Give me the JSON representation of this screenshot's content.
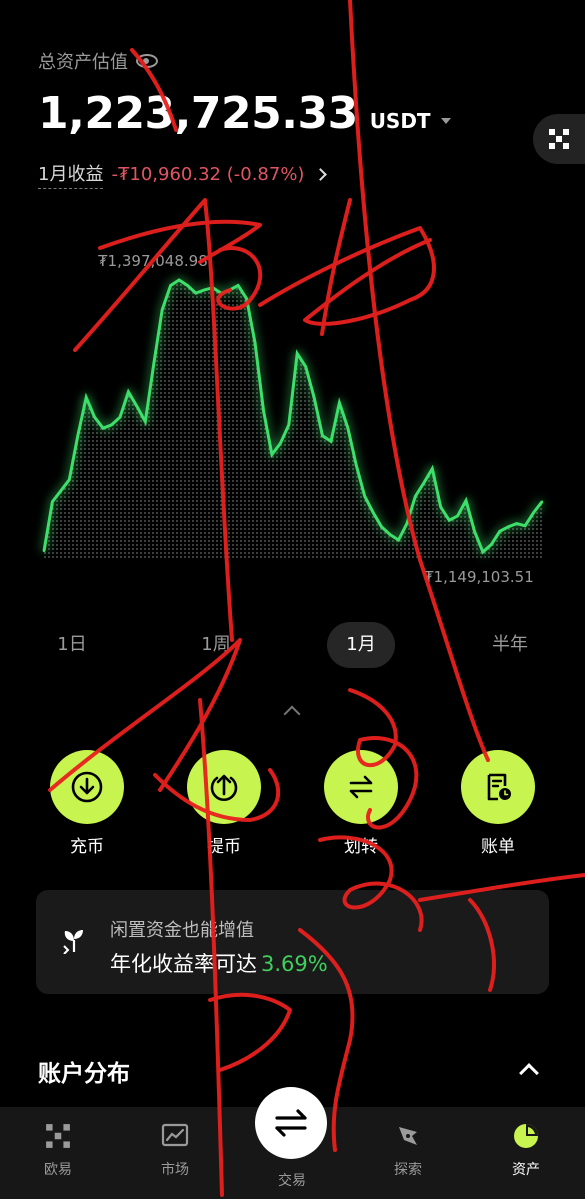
{
  "header": {
    "total_label": "总资产估值",
    "balance": "1,223,725.33",
    "currency": "USDT",
    "pnl_label": "1月收益",
    "pnl_value": "-₮10,960.32 (-0.87%)"
  },
  "chart": {
    "high_label": "₮1,397,048.98",
    "low_label": "₮1,149,103.51",
    "line_color": "#3ee06a"
  },
  "chart_data": {
    "type": "area",
    "title": "",
    "ylim": [
      1149103.51,
      1397048.98
    ],
    "values": [
      1150000,
      1195000,
      1205000,
      1215000,
      1255000,
      1290000,
      1272000,
      1262000,
      1265000,
      1272000,
      1295000,
      1282000,
      1268000,
      1320000,
      1370000,
      1392000,
      1397048.98,
      1392000,
      1385000,
      1388000,
      1390000,
      1385000,
      1388000,
      1392000,
      1380000,
      1340000,
      1278000,
      1238000,
      1248000,
      1265000,
      1330000,
      1318000,
      1290000,
      1255000,
      1250000,
      1285000,
      1262000,
      1228000,
      1200000,
      1185000,
      1172000,
      1165000,
      1160000,
      1175000,
      1200000,
      1212000,
      1225000,
      1190000,
      1178000,
      1182000,
      1196000,
      1168000,
      1149103.51,
      1156000,
      1168000,
      1172000,
      1175000,
      1173000,
      1185000,
      1195000
    ]
  },
  "periods": [
    "1日",
    "1周",
    "1月",
    "半年"
  ],
  "active_period": "1月",
  "actions": [
    {
      "label": "充币",
      "icon": "deposit-icon"
    },
    {
      "label": "提币",
      "icon": "withdraw-icon"
    },
    {
      "label": "划转",
      "icon": "transfer-icon"
    },
    {
      "label": "账单",
      "icon": "bill-icon"
    }
  ],
  "promo": {
    "line1": "闲置资金也能增值",
    "line2": "年化收益率可达",
    "rate": "3.69%"
  },
  "section": {
    "title": "账户分布"
  },
  "tabbar": [
    {
      "label": "欧易",
      "icon": "okx-logo-icon"
    },
    {
      "label": "市场",
      "icon": "market-chart-icon"
    },
    {
      "label": "交易",
      "icon": "trade-arrows-icon"
    },
    {
      "label": "探索",
      "icon": "explore-compass-icon"
    },
    {
      "label": "资产",
      "icon": "assets-pie-icon"
    }
  ],
  "colors": {
    "accent": "#c7f44e",
    "negative": "#e05563",
    "positive": "#3fcf5b",
    "annotation": "#e8201e"
  }
}
